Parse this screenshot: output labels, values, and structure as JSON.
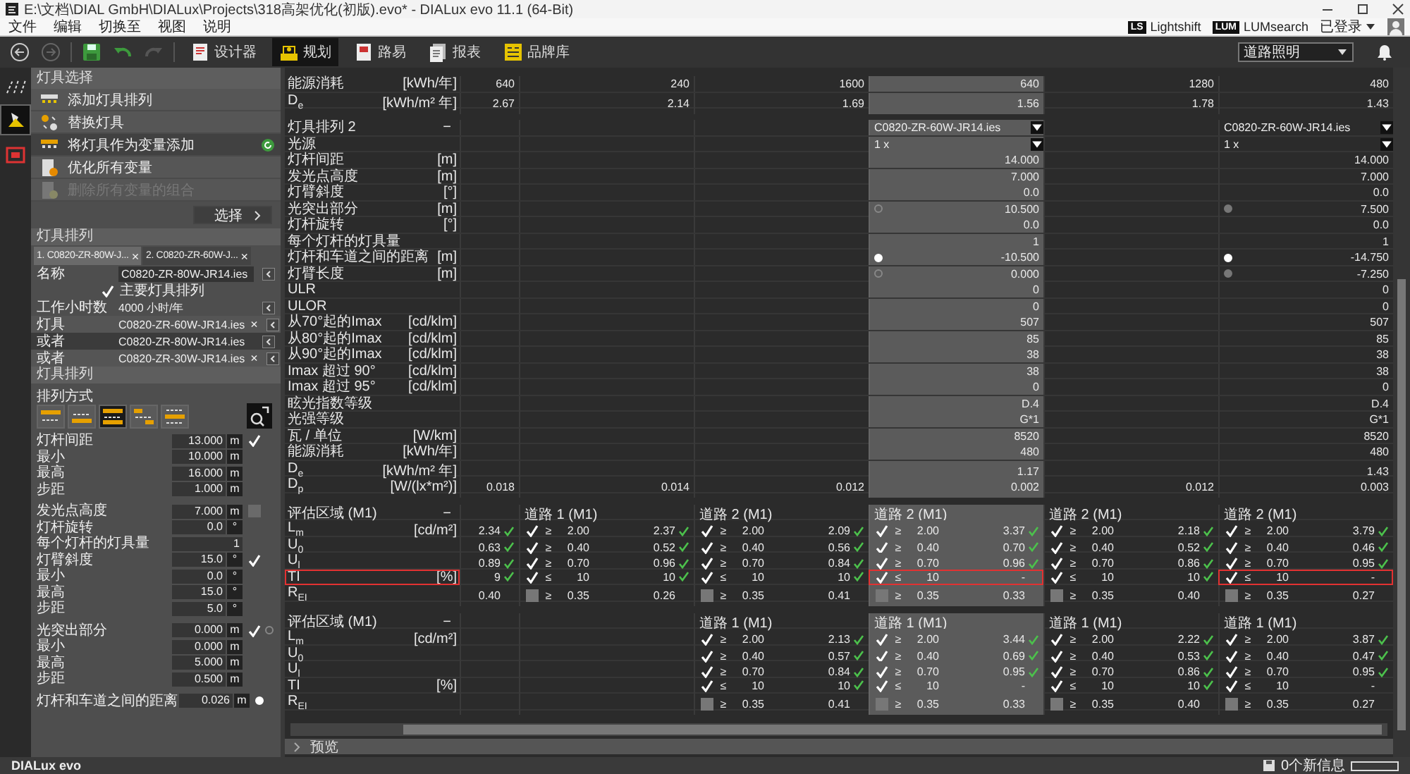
{
  "window": {
    "title": "E:\\文档\\DIAL GmbH\\DIALux\\Projects\\318高架优化(初版).evo* - DIALux evo 11.1  (64-Bit)"
  },
  "menu": [
    "文件",
    "编辑",
    "切换至",
    "视图",
    "说明"
  ],
  "plugins": [
    {
      "badge": "LS",
      "label": "Lightshift"
    },
    {
      "badge": "LUM",
      "label": "LUMsearch"
    }
  ],
  "account": {
    "label": "已登录"
  },
  "mode_tabs": [
    {
      "kind": "designer",
      "label": "设计器",
      "selected": false
    },
    {
      "kind": "planning",
      "label": "规划",
      "selected": true
    },
    {
      "kind": "road",
      "label": "路易",
      "selected": false
    },
    {
      "kind": "report",
      "label": "报表",
      "selected": false
    },
    {
      "kind": "catalog",
      "label": "品牌库",
      "selected": false
    }
  ],
  "workspace": {
    "value": "道路照明"
  },
  "side_tools": [
    {
      "kind": "roads",
      "selected": false
    },
    {
      "kind": "luminaire",
      "selected": true
    },
    {
      "kind": "screen",
      "selected": false
    }
  ],
  "luminaire_selection": {
    "title": "灯具选择",
    "actions": [
      {
        "kind": "add",
        "label": "添加灯具排列",
        "selected": false,
        "disabled": false
      },
      {
        "kind": "replace",
        "label": "替换灯具",
        "selected": false,
        "disabled": false
      },
      {
        "kind": "variant",
        "label": "将灯具作为变量添加",
        "selected": true,
        "disabled": false
      },
      {
        "kind": "optimize",
        "label": "优化所有变量",
        "selected": false,
        "disabled": false
      },
      {
        "kind": "delete",
        "label": "删除所有变量的组合",
        "selected": false,
        "disabled": true
      }
    ],
    "choose_button": "选择"
  },
  "arrangement": {
    "title": "灯具排列",
    "tabs": [
      {
        "label": "1. C0820-ZR-80W-J...",
        "close": "×",
        "selected": true
      },
      {
        "label": "2. C0820-ZR-60W-J...",
        "close": "×",
        "selected": false
      }
    ],
    "rows": [
      {
        "kind": "name",
        "label": "名称",
        "value": "C0820-ZR-80W-JR14.ies"
      },
      {
        "kind": "checkbox",
        "label": "主要灯具排列",
        "checked": true
      },
      {
        "kind": "text",
        "label": "工作小时数",
        "value": "4000 小时/年"
      },
      {
        "kind": "luminaire",
        "label": "灯具",
        "value": "C0820-ZR-60W-JR14.ies",
        "remove": "×",
        "selected": false
      },
      {
        "kind": "luminaire",
        "label": "或者",
        "value": "C0820-ZR-80W-JR14.ies",
        "selected": true
      },
      {
        "kind": "luminaire",
        "label": "或者",
        "value": "C0820-ZR-30W-JR14.ies",
        "remove": "×",
        "selected": false
      }
    ]
  },
  "layout": {
    "title": "灯具排列",
    "mode_label": "排列方式",
    "modes": [
      {
        "kind": "single-top",
        "selected": false
      },
      {
        "kind": "single-bottom",
        "selected": false
      },
      {
        "kind": "double",
        "selected": true
      },
      {
        "kind": "staggered",
        "selected": false
      },
      {
        "kind": "center",
        "selected": false
      }
    ],
    "groups": [
      [
        {
          "label": "灯杆间距",
          "value": "13.000",
          "unit": "m",
          "checked": true
        },
        {
          "label": "最小",
          "value": "10.000",
          "unit": "m"
        },
        {
          "label": "最高",
          "value": "16.000",
          "unit": "m"
        },
        {
          "label": "步距",
          "value": "1.000",
          "unit": "m"
        }
      ],
      [
        {
          "label": "发光点高度",
          "value": "7.000",
          "unit": "m",
          "checked": false
        },
        {
          "label": "灯杆旋转",
          "value": "0.0",
          "unit": "°"
        },
        {
          "label": "每个灯杆的灯具量",
          "value": "1"
        },
        {
          "label": "灯臂斜度",
          "value": "15.0",
          "unit": "°",
          "checked": true
        },
        {
          "label": "最小",
          "value": "0.0",
          "unit": "°"
        },
        {
          "label": "最高",
          "value": "15.0",
          "unit": "°"
        },
        {
          "label": "步距",
          "value": "5.0",
          "unit": "°"
        }
      ],
      [
        {
          "label": "光突出部分",
          "value": "0.000",
          "unit": "m",
          "checked": true,
          "radio": false
        },
        {
          "label": "最小",
          "value": "0.000",
          "unit": "m"
        },
        {
          "label": "最高",
          "value": "5.000",
          "unit": "m"
        },
        {
          "label": "步距",
          "value": "0.500",
          "unit": "m"
        }
      ],
      [
        {
          "label": "灯杆和车道之间的距离",
          "value": "0.026",
          "unit": "m",
          "radio": true
        }
      ]
    ]
  },
  "table": {
    "columns": [
      {
        "selected": false
      },
      {
        "selected": false
      },
      {
        "selected": false
      },
      {
        "selected": true
      },
      {
        "selected": false
      },
      {
        "selected": false
      }
    ],
    "sections": [
      {
        "kind": "values",
        "rows": [
          {
            "label": "能源消耗",
            "unit": "[kWh/年]",
            "cells": [
              "640",
              "240",
              "1600",
              "640",
              "1280",
              "480"
            ]
          },
          {
            "label": "D$_{e}$",
            "unit": "[kWh/m² 年]",
            "cells": [
              "2.67",
              "2.14",
              "1.69",
              "1.56",
              "1.78",
              "1.43"
            ]
          }
        ]
      },
      {
        "kind": "values",
        "rows": [
          {
            "label": "灯具排列 2",
            "toggle": "−",
            "cells": [
              null,
              null,
              null,
              {
                "kind": "dropdown",
                "value": "C0820-ZR-60W-JR14.ies"
              },
              null,
              {
                "kind": "dropdown",
                "value": "C0820-ZR-60W-JR14.ies"
              }
            ]
          },
          {
            "label": "光源",
            "cells": [
              null,
              null,
              null,
              {
                "kind": "dropdown",
                "value": "1 x"
              },
              null,
              {
                "kind": "dropdown",
                "value": "1 x"
              }
            ]
          },
          {
            "label": "灯杆间距",
            "unit": "[m]",
            "cells": [
              null,
              null,
              null,
              "14.000",
              null,
              "14.000"
            ]
          },
          {
            "label": "发光点高度",
            "unit": "[m]",
            "cells": [
              null,
              null,
              null,
              "7.000",
              null,
              "7.000"
            ]
          },
          {
            "label": "灯臂斜度",
            "unit": "[°]",
            "cells": [
              null,
              null,
              null,
              "0.0",
              null,
              "0.0"
            ]
          },
          {
            "label": "光突出部分",
            "unit": "[m]",
            "cells": [
              null,
              null,
              null,
              {
                "kind": "radio",
                "value": "10.500",
                "checked": false,
                "disabled": false
              },
              null,
              {
                "kind": "radio",
                "value": "7.500",
                "checked": false,
                "disabled": true
              }
            ]
          },
          {
            "label": "灯杆旋转",
            "unit": "[°]",
            "cells": [
              null,
              null,
              null,
              "0.0",
              null,
              "0.0"
            ]
          },
          {
            "label": "每个灯杆的灯具量",
            "cells": [
              null,
              null,
              null,
              "1",
              null,
              "1"
            ]
          },
          {
            "label": "灯杆和车道之间的距离",
            "unit": "[m]",
            "cells": [
              null,
              null,
              null,
              {
                "kind": "radio",
                "value": "-10.500",
                "checked": true,
                "disabled": false
              },
              null,
              {
                "kind": "radio",
                "value": "-14.750",
                "checked": true,
                "disabled": false
              }
            ]
          },
          {
            "label": "灯臂长度",
            "unit": "[m]",
            "cells": [
              null,
              null,
              null,
              {
                "kind": "radio",
                "value": "0.000",
                "checked": false,
                "disabled": false
              },
              null,
              {
                "kind": "radio",
                "value": "-7.250",
                "checked": false,
                "disabled": true
              }
            ]
          },
          {
            "label": "ULR",
            "cells": [
              null,
              null,
              null,
              "0",
              null,
              "0"
            ]
          },
          {
            "label": "ULOR",
            "cells": [
              null,
              null,
              null,
              "0",
              null,
              "0"
            ]
          },
          {
            "label": "从70°起的Imax",
            "unit": "[cd/klm]",
            "cells": [
              null,
              null,
              null,
              "507",
              null,
              "507"
            ]
          },
          {
            "label": "从80°起的Imax",
            "unit": "[cd/klm]",
            "cells": [
              null,
              null,
              null,
              "85",
              null,
              "85"
            ]
          },
          {
            "label": "从90°起的Imax",
            "unit": "[cd/klm]",
            "cells": [
              null,
              null,
              null,
              "38",
              null,
              "38"
            ]
          },
          {
            "label": "Imax 超过 90°",
            "unit": "[cd/klm]",
            "cells": [
              null,
              null,
              null,
              "38",
              null,
              "38"
            ]
          },
          {
            "label": "Imax 超过 95°",
            "unit": "[cd/klm]",
            "cells": [
              null,
              null,
              null,
              "0",
              null,
              "0"
            ]
          },
          {
            "label": "眩光指数等级",
            "cells": [
              null,
              null,
              null,
              "D.4",
              null,
              "D.4"
            ]
          },
          {
            "label": "光强等级",
            "cells": [
              null,
              null,
              null,
              "G*1",
              null,
              "G*1"
            ]
          },
          {
            "label": "瓦 / 单位",
            "unit": "[W/km]",
            "cells": [
              null,
              null,
              null,
              "8520",
              null,
              "8520"
            ]
          },
          {
            "label": "能源消耗",
            "unit": "[kWh/年]",
            "cells": [
              null,
              null,
              null,
              "480",
              null,
              "480"
            ]
          },
          {
            "label": "D$_{e}$",
            "unit": "[kWh/m² 年]",
            "cells": [
              null,
              null,
              null,
              "1.17",
              null,
              "1.43"
            ]
          },
          {
            "label": "D$_{p}$",
            "unit": "[W/(lx*m²)]",
            "cells": [
              "0.018",
              "0.014",
              "0.012",
              "0.002",
              "0.012",
              "0.003"
            ]
          }
        ]
      },
      {
        "kind": "evaluation",
        "title": "评估区域 (M1)",
        "toggle": "−",
        "headers": [
          {
            "kind": "blank"
          },
          {
            "kind": "area",
            "label": "道路 1 (M1)"
          },
          {
            "kind": "area",
            "label": "道路 2 (M1)"
          },
          {
            "kind": "area",
            "label": "道路 2 (M1)"
          },
          {
            "kind": "area",
            "label": "道路 2 (M1)"
          },
          {
            "kind": "area",
            "label": "道路 2 (M1)"
          }
        ],
        "rows": [
          {
            "label": "L$_{m}$",
            "unit": "[cd/m²]",
            "highlighted": false,
            "cells": [
              {
                "kind": "result",
                "value": "2.34",
                "passed": true
              },
              {
                "kind": "criterion",
                "checked": true,
                "operator": "≥",
                "threshold": "2.00",
                "value": "2.37",
                "passed": true,
                "highlighted": false
              },
              {
                "kind": "criterion",
                "checked": true,
                "operator": "≥",
                "threshold": "2.00",
                "value": "2.09",
                "passed": true,
                "highlighted": false
              },
              {
                "kind": "criterion",
                "checked": true,
                "operator": "≥",
                "threshold": "2.00",
                "value": "3.37",
                "passed": true,
                "highlighted": false
              },
              {
                "kind": "criterion",
                "checked": true,
                "operator": "≥",
                "threshold": "2.00",
                "value": "2.18",
                "passed": true,
                "highlighted": false
              },
              {
                "kind": "criterion",
                "checked": true,
                "operator": "≥",
                "threshold": "2.00",
                "value": "3.79",
                "passed": true,
                "highlighted": false
              }
            ]
          },
          {
            "label": "U$_{0}$",
            "highlighted": false,
            "cells": [
              {
                "kind": "result",
                "value": "0.63",
                "passed": true
              },
              {
                "kind": "criterion",
                "checked": true,
                "operator": "≥",
                "threshold": "0.40",
                "value": "0.52",
                "passed": true,
                "highlighted": false
              },
              {
                "kind": "criterion",
                "checked": true,
                "operator": "≥",
                "threshold": "0.40",
                "value": "0.56",
                "passed": true,
                "highlighted": false
              },
              {
                "kind": "criterion",
                "checked": true,
                "operator": "≥",
                "threshold": "0.40",
                "value": "0.70",
                "passed": true,
                "highlighted": false
              },
              {
                "kind": "criterion",
                "checked": true,
                "operator": "≥",
                "threshold": "0.40",
                "value": "0.52",
                "passed": true,
                "highlighted": false
              },
              {
                "kind": "criterion",
                "checked": true,
                "operator": "≥",
                "threshold": "0.40",
                "value": "0.46",
                "passed": true,
                "highlighted": false
              }
            ]
          },
          {
            "label": "U$_{l}$",
            "highlighted": false,
            "cells": [
              {
                "kind": "result",
                "value": "0.89",
                "passed": true
              },
              {
                "kind": "criterion",
                "checked": true,
                "operator": "≥",
                "threshold": "0.70",
                "value": "0.96",
                "passed": true,
                "highlighted": false
              },
              {
                "kind": "criterion",
                "checked": true,
                "operator": "≥",
                "threshold": "0.70",
                "value": "0.84",
                "passed": true,
                "highlighted": false
              },
              {
                "kind": "criterion",
                "checked": true,
                "operator": "≥",
                "threshold": "0.70",
                "value": "0.96",
                "passed": true,
                "highlighted": false
              },
              {
                "kind": "criterion",
                "checked": true,
                "operator": "≥",
                "threshold": "0.70",
                "value": "0.86",
                "passed": true,
                "highlighted": false
              },
              {
                "kind": "criterion",
                "checked": true,
                "operator": "≥",
                "threshold": "0.70",
                "value": "0.95",
                "passed": true,
                "highlighted": false
              }
            ]
          },
          {
            "label": "TI",
            "unit": "[%]",
            "highlighted": true,
            "cells": [
              {
                "kind": "result",
                "value": "9",
                "passed": true
              },
              {
                "kind": "criterion",
                "checked": true,
                "operator": "≤",
                "threshold": "10",
                "value": "10",
                "passed": true,
                "highlighted": false
              },
              {
                "kind": "criterion",
                "checked": true,
                "operator": "≤",
                "threshold": "10",
                "value": "10",
                "passed": true,
                "highlighted": false
              },
              {
                "kind": "criterion",
                "checked": true,
                "operator": "≤",
                "threshold": "10",
                "value": "-",
                "passed": false,
                "highlighted": true
              },
              {
                "kind": "criterion",
                "checked": true,
                "operator": "≤",
                "threshold": "10",
                "value": "10",
                "passed": true,
                "highlighted": false
              },
              {
                "kind": "criterion",
                "checked": true,
                "operator": "≤",
                "threshold": "10",
                "value": "-",
                "passed": false,
                "highlighted": true
              }
            ]
          },
          {
            "label": "R$_{EI}$",
            "highlighted": false,
            "cells": [
              {
                "kind": "result",
                "value": "0.40",
                "passed": false
              },
              {
                "kind": "criterion",
                "checked": false,
                "operator": "≥",
                "threshold": "0.35",
                "value": "0.26",
                "passed": false,
                "highlighted": false
              },
              {
                "kind": "criterion",
                "checked": false,
                "operator": "≥",
                "threshold": "0.35",
                "value": "0.41",
                "passed": false,
                "highlighted": false
              },
              {
                "kind": "criterion",
                "checked": false,
                "operator": "≥",
                "threshold": "0.35",
                "value": "0.33",
                "passed": false,
                "highlighted": false
              },
              {
                "kind": "criterion",
                "checked": false,
                "operator": "≥",
                "threshold": "0.35",
                "value": "0.40",
                "passed": false,
                "highlighted": false
              },
              {
                "kind": "criterion",
                "checked": false,
                "operator": "≥",
                "threshold": "0.35",
                "value": "0.27",
                "passed": false,
                "highlighted": false
              }
            ]
          }
        ]
      },
      {
        "kind": "evaluation",
        "title": "评估区域 (M1)",
        "toggle": "−",
        "headers": [
          {
            "kind": "blank"
          },
          {
            "kind": "blank"
          },
          {
            "kind": "area",
            "label": "道路 1 (M1)"
          },
          {
            "kind": "area",
            "label": "道路 1 (M1)"
          },
          {
            "kind": "area",
            "label": "道路 1 (M1)"
          },
          {
            "kind": "area",
            "label": "道路 1 (M1)"
          }
        ],
        "rows": [
          {
            "label": "L$_{m}$",
            "unit": "[cd/m²]",
            "highlighted": false,
            "cells": [
              null,
              null,
              {
                "kind": "criterion",
                "checked": true,
                "operator": "≥",
                "threshold": "2.00",
                "value": "2.13",
                "passed": true,
                "highlighted": false
              },
              {
                "kind": "criterion",
                "checked": true,
                "operator": "≥",
                "threshold": "2.00",
                "value": "3.44",
                "passed": true,
                "highlighted": false
              },
              {
                "kind": "criterion",
                "checked": true,
                "operator": "≥",
                "threshold": "2.00",
                "value": "2.22",
                "passed": true,
                "highlighted": false
              },
              {
                "kind": "criterion",
                "checked": true,
                "operator": "≥",
                "threshold": "2.00",
                "value": "3.87",
                "passed": true,
                "highlighted": false
              }
            ]
          },
          {
            "label": "U$_{0}$",
            "highlighted": false,
            "cells": [
              null,
              null,
              {
                "kind": "criterion",
                "checked": true,
                "operator": "≥",
                "threshold": "0.40",
                "value": "0.57",
                "passed": true,
                "highlighted": false
              },
              {
                "kind": "criterion",
                "checked": true,
                "operator": "≥",
                "threshold": "0.40",
                "value": "0.69",
                "passed": true,
                "highlighted": false
              },
              {
                "kind": "criterion",
                "checked": true,
                "operator": "≥",
                "threshold": "0.40",
                "value": "0.53",
                "passed": true,
                "highlighted": false
              },
              {
                "kind": "criterion",
                "checked": true,
                "operator": "≥",
                "threshold": "0.40",
                "value": "0.47",
                "passed": true,
                "highlighted": false
              }
            ]
          },
          {
            "label": "U$_{l}$",
            "highlighted": false,
            "cells": [
              null,
              null,
              {
                "kind": "criterion",
                "checked": true,
                "operator": "≥",
                "threshold": "0.70",
                "value": "0.84",
                "passed": true,
                "highlighted": false
              },
              {
                "kind": "criterion",
                "checked": true,
                "operator": "≥",
                "threshold": "0.70",
                "value": "0.95",
                "passed": true,
                "highlighted": false
              },
              {
                "kind": "criterion",
                "checked": true,
                "operator": "≥",
                "threshold": "0.70",
                "value": "0.86",
                "passed": true,
                "highlighted": false
              },
              {
                "kind": "criterion",
                "checked": true,
                "operator": "≥",
                "threshold": "0.70",
                "value": "0.95",
                "passed": true,
                "highlighted": false
              }
            ]
          },
          {
            "label": "TI",
            "unit": "[%]",
            "highlighted": false,
            "cells": [
              null,
              null,
              {
                "kind": "criterion",
                "checked": true,
                "operator": "≤",
                "threshold": "10",
                "value": "10",
                "passed": true,
                "highlighted": false
              },
              {
                "kind": "criterion",
                "checked": true,
                "operator": "≤",
                "threshold": "10",
                "value": "-",
                "passed": false,
                "highlighted": false
              },
              {
                "kind": "criterion",
                "checked": true,
                "operator": "≤",
                "threshold": "10",
                "value": "10",
                "passed": true,
                "highlighted": false
              },
              {
                "kind": "criterion",
                "checked": true,
                "operator": "≤",
                "threshold": "10",
                "value": "-",
                "passed": false,
                "highlighted": false
              }
            ]
          },
          {
            "label": "R$_{EI}$",
            "highlighted": false,
            "cells": [
              null,
              null,
              {
                "kind": "criterion",
                "checked": false,
                "operator": "≥",
                "threshold": "0.35",
                "value": "0.41",
                "passed": false,
                "highlighted": false
              },
              {
                "kind": "criterion",
                "checked": false,
                "operator": "≥",
                "threshold": "0.35",
                "value": "0.33",
                "passed": false,
                "highlighted": false
              },
              {
                "kind": "criterion",
                "checked": false,
                "operator": "≥",
                "threshold": "0.35",
                "value": "0.40",
                "passed": false,
                "highlighted": false
              },
              {
                "kind": "criterion",
                "checked": false,
                "operator": "≥",
                "threshold": "0.35",
                "value": "0.27",
                "passed": false,
                "highlighted": false
              }
            ]
          }
        ]
      }
    ]
  },
  "preview": {
    "label": "预览"
  },
  "status_bar": {
    "app": "DIALux evo",
    "messages": "0个新信息",
    "progress": {
      "level": 0
    }
  }
}
